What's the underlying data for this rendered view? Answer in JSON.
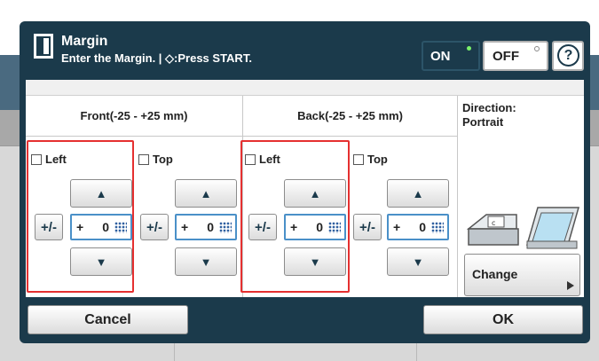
{
  "header": {
    "title": "Margin",
    "subtitle": "Enter the Margin. | ◇:Press START.",
    "on_label": "ON",
    "off_label": "OFF",
    "help_label": "?"
  },
  "columns": {
    "front_header": "Front(-25 - +25 mm)",
    "back_header": "Back(-25 - +25 mm)",
    "direction_label": "Direction:",
    "direction_value": "Portrait"
  },
  "front": {
    "left": {
      "label": "Left",
      "checked": false,
      "sign": "+",
      "value": "0"
    },
    "top": {
      "label": "Top",
      "checked": false,
      "sign": "+",
      "value": "0"
    }
  },
  "back": {
    "left": {
      "label": "Left",
      "checked": false,
      "sign": "+",
      "value": "0"
    },
    "top": {
      "label": "Top",
      "checked": false,
      "sign": "+",
      "value": "0"
    }
  },
  "glyphs": {
    "up": "▲",
    "down": "▼",
    "plusminus": "+/-"
  },
  "direction": {
    "change_label": "Change"
  },
  "footer": {
    "cancel_label": "Cancel",
    "ok_label": "OK"
  },
  "colors": {
    "screen_bg": "#1b3a4b",
    "highlight_box": "#e53030",
    "on_indicator": "#7bf26a"
  }
}
